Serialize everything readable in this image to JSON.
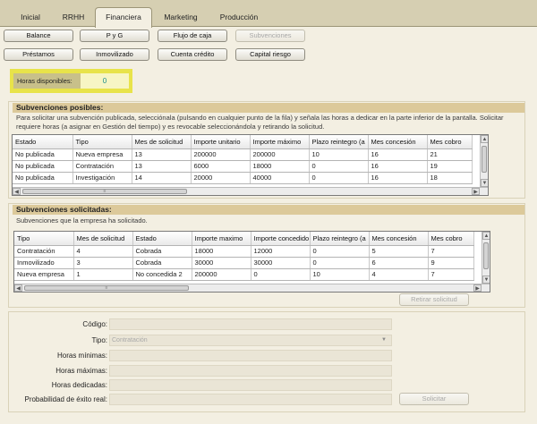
{
  "tabs": [
    {
      "label": "Inicial"
    },
    {
      "label": "RRHH"
    },
    {
      "label": "Financiera"
    },
    {
      "label": "Marketing"
    },
    {
      "label": "Producción"
    }
  ],
  "toolbar": {
    "row1": [
      {
        "label": "Balance"
      },
      {
        "label": "P y G"
      },
      {
        "label": "Flujo de caja"
      },
      {
        "label": "Subvenciones"
      }
    ],
    "row2": [
      {
        "label": "Préstamos"
      },
      {
        "label": "Inmovilizado"
      },
      {
        "label": "Cuenta crédito"
      },
      {
        "label": "Capital riesgo"
      }
    ]
  },
  "hours": {
    "label": "Horas disponibles:",
    "value": "0"
  },
  "posibles": {
    "title": "Subvenciones posibles:",
    "description": "Para solicitar una subvención publicada, selecciónala (pulsando en cualquier punto de la fila) y señala las horas a dedicar en la parte inferior de la pantalla. Solicitar requiere horas (a asignar en Gestión del tiempo) y es revocable seleccionándola y retirando la solicitud.",
    "columns": [
      "Estado",
      "Tipo",
      "Mes de solicitud",
      "Importe unitario",
      "Importe máximo",
      "Plazo reintegro (a",
      "Mes concesión",
      "Mes cobro"
    ],
    "rows": [
      [
        "No publicada",
        "Nueva empresa",
        "13",
        "200000",
        "200000",
        "10",
        "16",
        "21"
      ],
      [
        "No publicada",
        "Contratación",
        "13",
        "6000",
        "18000",
        "0",
        "16",
        "19"
      ],
      [
        "No publicada",
        "Investigación",
        "14",
        "20000",
        "40000",
        "0",
        "16",
        "18"
      ]
    ]
  },
  "solicitadas": {
    "title": "Subvenciones solicitadas:",
    "description": "Subvenciones que la empresa ha solicitado.",
    "columns": [
      "Tipo",
      "Mes de solicitud",
      "Estado",
      "Importe maximo",
      "Importe concedido",
      "Plazo reintegro (a",
      "Mes concesión",
      "Mes cobro"
    ],
    "rows": [
      [
        "Contratación",
        "4",
        "Cobrada",
        "18000",
        "12000",
        "0",
        "5",
        "7"
      ],
      [
        "Inmovilizado",
        "3",
        "Cobrada",
        "30000",
        "30000",
        "0",
        "6",
        "9"
      ],
      [
        "Nueva empresa",
        "1",
        "No concedida 2",
        "200000",
        "0",
        "10",
        "4",
        "7"
      ]
    ],
    "withdraw_label": "Retirar solicitud"
  },
  "form": {
    "codigo": {
      "label": "Código:",
      "value": ""
    },
    "tipo": {
      "label": "Tipo:",
      "value": "Contratación"
    },
    "horas_minimas": {
      "label": "Horas mínimas:",
      "value": ""
    },
    "horas_maximas": {
      "label": "Horas máximas:",
      "value": ""
    },
    "horas_dedicadas": {
      "label": "Horas dedicadas:",
      "value": ""
    },
    "probabilidad": {
      "label": "Probabilidad de éxito real:",
      "value": ""
    },
    "submit_label": "Solicitar"
  },
  "colors": {
    "accent_yellow": "#e8e34a",
    "panel_header": "#dcc99a",
    "tab_bar": "#d6cfb2",
    "hours_value": "#1a8c8c"
  }
}
